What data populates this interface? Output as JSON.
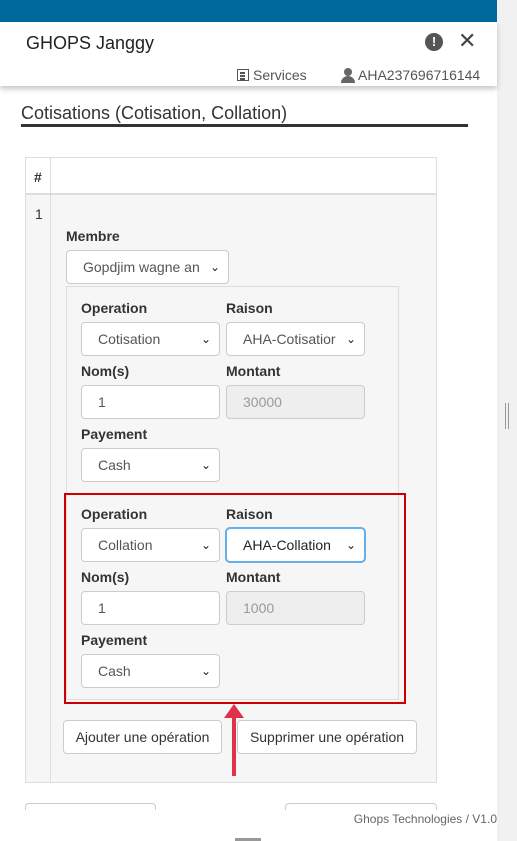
{
  "header": {
    "title": "GHOPS Janggy",
    "alert_icon": "exclamation-circle-icon",
    "close_icon": "close-icon",
    "services_label": "Services",
    "account_id": "AHA237696716144"
  },
  "section": {
    "title": "Cotisations (Cotisation, Collation)"
  },
  "table": {
    "header_hash": "#",
    "row_number": "1"
  },
  "membre": {
    "label": "Membre",
    "value": "Gopdjim wagne an"
  },
  "operations": [
    {
      "operation_label": "Operation",
      "operation_value": "Cotisation",
      "raison_label": "Raison",
      "raison_value": "AHA-Cotisatior",
      "noms_label": "Nom(s)",
      "noms_value": "1",
      "montant_label": "Montant",
      "montant_value": "30000",
      "payement_label": "Payement",
      "payement_value": "Cash"
    },
    {
      "operation_label": "Operation",
      "operation_value": "Collation",
      "raison_label": "Raison",
      "raison_value": "AHA-Collation",
      "noms_label": "Nom(s)",
      "noms_value": "1",
      "montant_label": "Montant",
      "montant_value": "1000",
      "payement_label": "Payement",
      "payement_value": "Cash"
    }
  ],
  "actions": {
    "add_label": "Ajouter une opération",
    "remove_label": "Supprimer une opération"
  },
  "footer": {
    "text": "Ghops Technologies / V1.0"
  },
  "colors": {
    "topbar": "#00699b",
    "highlight": "#cc0000",
    "arrow": "#e0324b"
  }
}
